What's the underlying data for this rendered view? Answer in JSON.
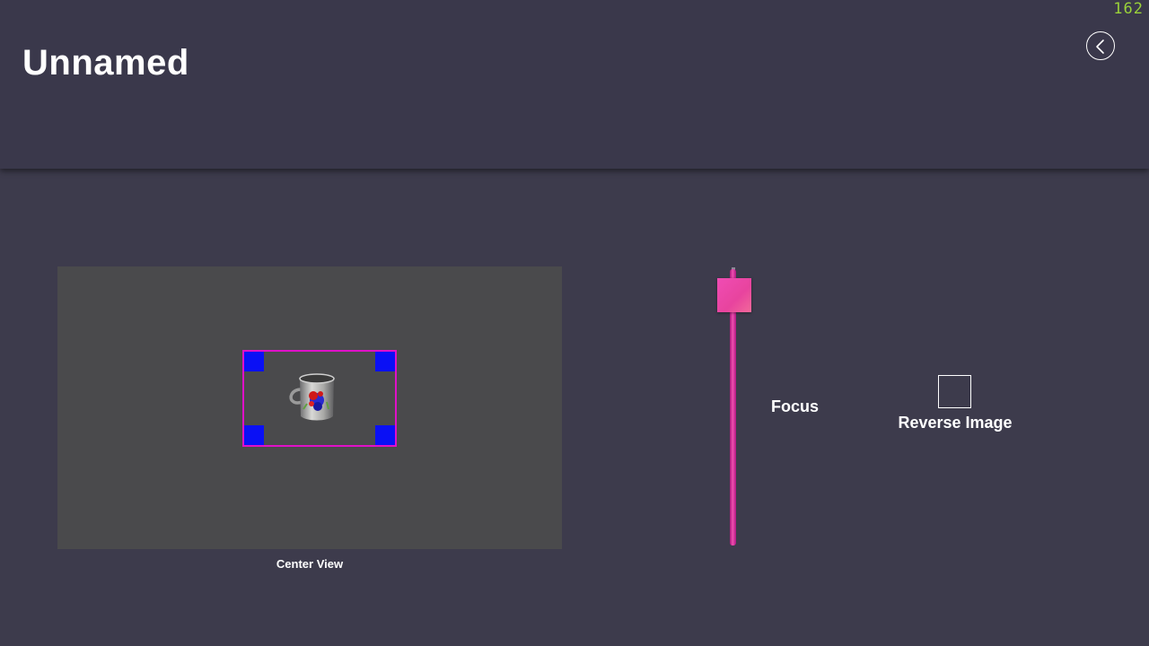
{
  "header": {
    "title": "Unnamed",
    "fps_counter": "162",
    "back_icon": "chevron-left-circle-icon"
  },
  "preview": {
    "caption": "Center View",
    "frame_color": "#e010c8",
    "handle_color": "#0a10f5",
    "image_subject": "mug"
  },
  "focus_slider": {
    "label": "Focus",
    "value": 1.0,
    "accent": "#e8449e"
  },
  "reverse_image": {
    "label": "Reverse Image",
    "checked": false
  }
}
